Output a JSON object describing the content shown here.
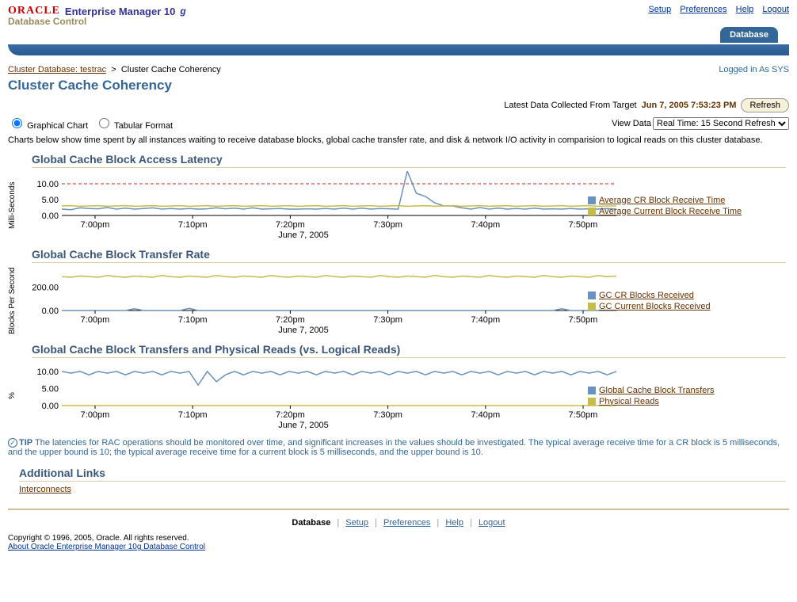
{
  "header": {
    "logo_oracle": "ORACLE",
    "product": "Enterprise Manager 10",
    "product_g": "g",
    "db_control": "Database Control",
    "links": {
      "setup": "Setup",
      "prefs": "Preferences",
      "help": "Help",
      "logout": "Logout"
    },
    "tab": "Database"
  },
  "breadcrumb": {
    "link": "Cluster Database: testrac",
    "sep": ">",
    "current": "Cluster Cache Coherency"
  },
  "logged_in": "Logged in As SYS",
  "title": "Cluster Cache Coherency",
  "refresh": {
    "label": "Latest Data Collected From Target",
    "ts": "Jun 7, 2005 7:53:23 PM",
    "btn": "Refresh"
  },
  "view": {
    "radio1": "Graphical Chart",
    "radio2": "Tabular Format",
    "label": "View Data",
    "select": "Real Time: 15 Second Refresh"
  },
  "desc": "Charts below show time spent by all instances waiting to receive database blocks, global cache transfer rate, and disk & network I/O activity in comparision to logical reads on this cluster database.",
  "x_categories": [
    "7:00pm",
    "7:10pm",
    "7:20pm",
    "7:30pm",
    "7:40pm",
    "7:50pm"
  ],
  "x_date": "June 7, 2005",
  "colors": {
    "blue": "#6a92c0",
    "olive": "#c5bc49",
    "red": "#cc2222"
  },
  "chart_data": [
    {
      "type": "line",
      "title": "Global Cache Block Access Latency",
      "ylabel": "Milli-Seconds",
      "ylim": [
        0,
        14
      ],
      "yticks": [
        0,
        5,
        10
      ],
      "threshold": 10,
      "series": [
        {
          "name": "Average CR Block Receive Time",
          "color": "blue",
          "values": [
            2.0,
            1.8,
            2.4,
            2.2,
            2.1,
            2.5,
            2.0,
            2.3,
            2.0,
            2.2,
            2.4,
            2.0,
            2.2,
            2.0,
            2.2,
            2.0,
            2.1,
            2.4,
            2.1,
            2.3,
            2.0,
            2.4,
            2.0,
            2.1,
            2.2,
            2.0,
            2.0,
            2.1,
            2.0,
            2.2,
            2.0,
            2.3,
            2.0,
            2.3,
            2.0,
            2.2,
            2.1,
            2.0,
            14,
            7,
            6.0,
            4.0,
            3.0,
            3.0,
            2.4,
            2.0,
            2.5,
            2.0,
            2.3,
            2.0,
            2.2,
            2.0,
            2.3,
            2.0,
            2.1,
            2.0,
            2.2,
            2.0,
            2.1,
            2.0,
            2.2,
            2.0
          ]
        },
        {
          "name": "Average Current Block Receive Time",
          "color": "olive",
          "values": [
            3.0,
            3.1,
            2.9,
            3.0,
            3.1,
            2.9,
            3.0,
            3.1,
            2.9,
            3.0,
            3.1,
            2.9,
            3.0,
            3.1,
            2.9,
            3.0,
            3.1,
            2.9,
            3.0,
            3.1,
            2.9,
            3.0,
            3.1,
            2.9,
            3.0,
            3.1,
            2.9,
            3.0,
            3.1,
            2.9,
            3.0,
            3.1,
            2.9,
            3.0,
            3.1,
            2.9,
            3.0,
            3.1,
            2.9,
            3.0,
            3.1,
            2.9,
            3.0,
            3.1,
            2.9,
            3.0,
            3.1,
            2.9,
            3.0,
            3.1,
            2.9,
            3.0,
            3.1,
            2.9,
            3.0,
            3.1,
            2.9,
            3.0,
            3.1,
            2.9,
            3.0,
            3.0
          ]
        }
      ]
    },
    {
      "type": "line",
      "title": "Global Cache Block Transfer Rate",
      "ylabel": "Blocks Per Second",
      "ylim": [
        0,
        380
      ],
      "yticks": [
        0,
        200
      ],
      "series": [
        {
          "name": "GC CR Blocks Received",
          "color": "blue",
          "values": [
            0,
            0,
            0,
            0,
            0,
            0,
            0,
            0,
            15,
            0,
            0,
            0,
            0,
            0,
            18,
            0,
            0,
            0,
            0,
            0,
            0,
            0,
            0,
            0,
            0,
            0,
            0,
            0,
            0,
            0,
            0,
            0,
            0,
            0,
            0,
            0,
            0,
            0,
            0,
            0,
            0,
            0,
            0,
            0,
            0,
            0,
            0,
            0,
            0,
            0,
            0,
            0,
            0,
            0,
            0,
            15,
            0,
            0,
            0,
            0,
            0,
            0
          ]
        },
        {
          "name": "GC Current Blocks Received",
          "color": "olive",
          "values": [
            290,
            285,
            295,
            290,
            285,
            300,
            290,
            285,
            295,
            290,
            285,
            300,
            290,
            285,
            295,
            290,
            285,
            300,
            290,
            285,
            295,
            290,
            285,
            300,
            290,
            285,
            295,
            290,
            285,
            300,
            290,
            285,
            295,
            290,
            285,
            300,
            290,
            285,
            295,
            290,
            285,
            300,
            290,
            285,
            295,
            290,
            285,
            300,
            290,
            285,
            295,
            290,
            285,
            300,
            290,
            285,
            295,
            290,
            285,
            300,
            290,
            295
          ]
        }
      ]
    },
    {
      "type": "line",
      "title": "Global Cache Block Transfers and Physical Reads (vs. Logical Reads)",
      "ylabel": "%",
      "ylim": [
        0,
        13
      ],
      "yticks": [
        0,
        5,
        10
      ],
      "series": [
        {
          "name": "Global Cache Block Transfers",
          "color": "blue",
          "values": [
            10,
            9.5,
            10,
            9,
            10,
            9.5,
            10,
            9,
            10,
            9.5,
            10,
            9,
            10,
            9.5,
            10,
            6,
            10,
            7,
            9,
            10,
            9,
            10,
            9.5,
            10,
            9,
            10,
            9.5,
            10,
            9,
            10,
            9.5,
            10,
            9,
            10,
            9.5,
            10,
            9,
            10,
            9.5,
            10,
            9,
            10,
            9.5,
            10,
            9,
            10,
            9.5,
            10,
            9,
            10,
            9.5,
            10,
            9,
            10,
            9.5,
            10,
            9,
            10,
            9.5,
            10,
            9,
            10
          ]
        },
        {
          "name": "Physical Reads",
          "color": "olive",
          "values": [
            0,
            0,
            0,
            0,
            0,
            0,
            0,
            0,
            0,
            0,
            0,
            0,
            0,
            0,
            0,
            0,
            0,
            0,
            0,
            0,
            0,
            0,
            0,
            0,
            0,
            0,
            0,
            0,
            0,
            0,
            0,
            0,
            0,
            0,
            0,
            0,
            0,
            0,
            0,
            0,
            0,
            0,
            0,
            0,
            0,
            0,
            0,
            0,
            0,
            0,
            0,
            0,
            0,
            0,
            0,
            0,
            0,
            0,
            0,
            0,
            0,
            0
          ]
        }
      ]
    }
  ],
  "tip": {
    "label": "TIP",
    "text": "The latencies for RAC operations should be monitored over time, and significant increases in the values should be investigated. The typical average receive time for a CR block is 5 milliseconds, and the upper bound is 10; the typical average receive time for a current block is 5 milliseconds, and the upper bound is 10."
  },
  "addl": {
    "heading": "Additional Links",
    "link": "Interconnects"
  },
  "footer": {
    "nav": {
      "database": "Database",
      "setup": "Setup",
      "prefs": "Preferences",
      "help": "Help",
      "logout": "Logout"
    },
    "copyright": "Copyright © 1996, 2005, Oracle. All rights reserved.",
    "about": "About Oracle Enterprise Manager 10g Database Control"
  }
}
